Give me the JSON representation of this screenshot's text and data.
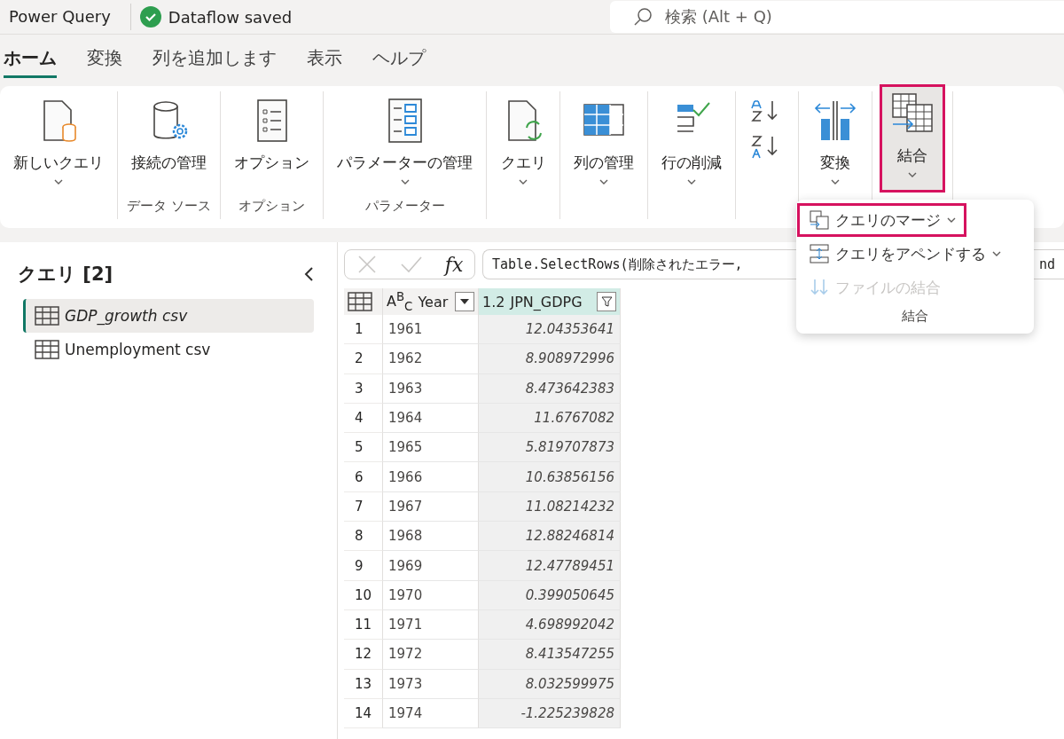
{
  "app_title": "Power Query",
  "status": {
    "text": "Dataflow saved",
    "saved": true
  },
  "search": {
    "placeholder": "検索 (Alt + Q)"
  },
  "tabs": [
    {
      "label": "ホーム",
      "selected": true
    },
    {
      "label": "変換",
      "selected": false
    },
    {
      "label": "列を追加します",
      "selected": false
    },
    {
      "label": "表示",
      "selected": false
    },
    {
      "label": "ヘルプ",
      "selected": false
    }
  ],
  "ribbon": {
    "groups": [
      {
        "buttons": [
          {
            "kind": "new_query",
            "label": "新しいクエリ",
            "dropdown": true,
            "highlighted": false
          }
        ]
      },
      {
        "label": "データ ソース",
        "buttons": [
          {
            "kind": "connections",
            "label": "接続の管理",
            "dropdown": false,
            "highlighted": false
          }
        ]
      },
      {
        "label": "オプション",
        "buttons": [
          {
            "kind": "options",
            "label": "オプション",
            "dropdown": false,
            "highlighted": false
          }
        ]
      },
      {
        "label": "パラメーター",
        "buttons": [
          {
            "kind": "parameters",
            "label": "パラメーターの管理",
            "dropdown": true,
            "highlighted": false
          }
        ]
      },
      {
        "buttons": [
          {
            "kind": "query",
            "label": "クエリ",
            "dropdown": true,
            "highlighted": false
          }
        ]
      },
      {
        "buttons": [
          {
            "kind": "columns",
            "label": "列の管理",
            "dropdown": true,
            "highlighted": false
          }
        ]
      },
      {
        "buttons": [
          {
            "kind": "rows",
            "label": "行の削減",
            "dropdown": true,
            "highlighted": false
          }
        ]
      },
      {
        "buttons": [
          {
            "kind": "sort",
            "dropdown": false,
            "highlighted": false
          }
        ]
      },
      {
        "buttons": [
          {
            "kind": "transform",
            "label": "変換",
            "dropdown": true,
            "highlighted": false
          }
        ]
      },
      {
        "buttons": [
          {
            "kind": "combine",
            "label": "結合",
            "dropdown": true,
            "highlighted": true
          }
        ]
      }
    ]
  },
  "menu": {
    "items": [
      {
        "kind": "merge",
        "label": "クエリのマージ",
        "dropdown": true,
        "highlighted": true,
        "disabled": false
      },
      {
        "kind": "append",
        "label": "クエリをアペンドする",
        "dropdown": true,
        "highlighted": false,
        "disabled": false
      },
      {
        "kind": "files",
        "label": "ファイルの結合",
        "dropdown": false,
        "highlighted": false,
        "disabled": true
      }
    ],
    "group_label": "結合"
  },
  "queries": {
    "title": "クエリ [2]",
    "items": [
      {
        "label": "GDP_growth csv",
        "selected": true
      },
      {
        "label": "Unemployment csv",
        "selected": false
      }
    ]
  },
  "formula": {
    "fx_label": "fx",
    "text": "Table.SelectRows(削除されたエラー,",
    "tail": "nd"
  },
  "table": {
    "columns": [
      {
        "type_label": "A$^{B}$$_{C}$",
        "label": "Year",
        "selected": false
      },
      {
        "type_label": "1.2",
        "label": "JPN_GDPG",
        "selected": true
      }
    ],
    "rows": [
      {
        "number": "1",
        "values": [
          "1961",
          "12.04353641"
        ]
      },
      {
        "number": "2",
        "values": [
          "1962",
          "8.908972996"
        ]
      },
      {
        "number": "3",
        "values": [
          "1963",
          "8.473642383"
        ]
      },
      {
        "number": "4",
        "values": [
          "1964",
          "11.6767082"
        ]
      },
      {
        "number": "5",
        "values": [
          "1965",
          "5.819707873"
        ]
      },
      {
        "number": "6",
        "values": [
          "1966",
          "10.63856156"
        ]
      },
      {
        "number": "7",
        "values": [
          "1967",
          "11.08214232"
        ]
      },
      {
        "number": "8",
        "values": [
          "1968",
          "12.88246814"
        ]
      },
      {
        "number": "9",
        "values": [
          "1969",
          "12.47789451"
        ]
      },
      {
        "number": "10",
        "values": [
          "1970",
          "0.399050645"
        ]
      },
      {
        "number": "11",
        "values": [
          "1971",
          "4.698992042"
        ]
      },
      {
        "number": "12",
        "values": [
          "1972",
          "8.413547255"
        ]
      },
      {
        "number": "13",
        "values": [
          "1973",
          "8.032599975"
        ]
      },
      {
        "number": "14",
        "values": [
          "1974",
          "-1.225239828"
        ]
      }
    ]
  }
}
